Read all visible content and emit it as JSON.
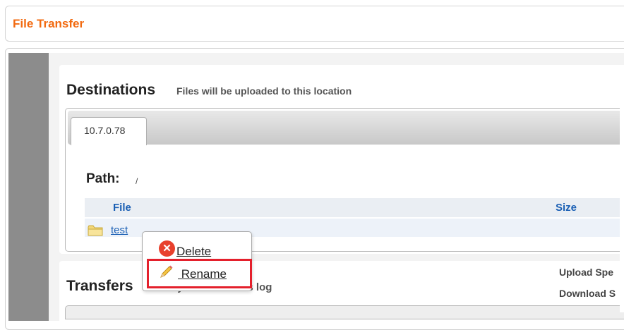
{
  "header": {
    "title": "File Transfer"
  },
  "destinations": {
    "heading": "Destinations",
    "subtitle": "Files will be uploaded to this location",
    "tabs": [
      {
        "label": "10.7.0.78",
        "active": true
      }
    ],
    "path_label": "Path:",
    "path_value": "/",
    "columns": {
      "file": "File",
      "size": "Size"
    },
    "files": [
      {
        "name": "test",
        "type": "folder",
        "icon": "folder-icon"
      }
    ]
  },
  "transfers": {
    "heading": "Transfers",
    "subtitle_visible": "elivery and transfers log",
    "upload_speed_label": "Upload Spe",
    "download_speed_label": "Download S"
  },
  "context_menu": {
    "items": [
      {
        "label": "Delete",
        "icon": "delete-icon"
      },
      {
        "label": " Rename",
        "icon": "pencil-icon",
        "highlighted": true
      }
    ]
  },
  "colors": {
    "accent": "#f26a10",
    "link": "#1a5fb4",
    "highlight": "#e4202c",
    "delete": "#e8402c"
  }
}
